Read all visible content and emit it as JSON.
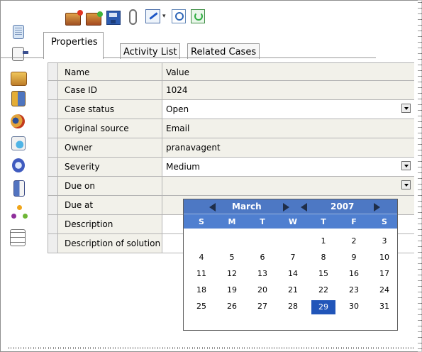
{
  "toolbar": {
    "buttons": [
      "new-case-icon",
      "open-case-icon",
      "save-icon",
      "attachment-icon",
      "edit-icon",
      "find-icon",
      "refresh-icon"
    ]
  },
  "sidebar": {
    "items": [
      "notes-icon",
      "form-icon",
      "case-icon",
      "people-icon",
      "contact-icon",
      "report-icon",
      "book-icon",
      "document-icon",
      "network-icon",
      "workflow-icon"
    ]
  },
  "tabs": [
    {
      "label": "Properties",
      "active": true
    },
    {
      "label": "Activity List",
      "active": false
    },
    {
      "label": "Related Cases",
      "active": false
    }
  ],
  "grid": {
    "header": {
      "name": "Name",
      "value": "Value"
    },
    "rows": [
      {
        "name": "Case ID",
        "value": "1024"
      },
      {
        "name": "Case status",
        "value": "Open"
      },
      {
        "name": "Original source",
        "value": "Email"
      },
      {
        "name": "Owner",
        "value": "pranavagent"
      },
      {
        "name": "Severity",
        "value": "Medium"
      },
      {
        "name": "Due on",
        "value": ""
      },
      {
        "name": "Due at",
        "value": ""
      },
      {
        "name": "Description",
        "value": ""
      },
      {
        "name": "Description of solution",
        "value": ""
      }
    ]
  },
  "calendar": {
    "month": "March",
    "year": "2007",
    "weekdays": [
      "S",
      "M",
      "T",
      "W",
      "T",
      "F",
      "S"
    ],
    "weeks": [
      [
        "",
        "",
        "",
        "",
        "1",
        "2",
        "3"
      ],
      [
        "4",
        "5",
        "6",
        "7",
        "8",
        "9",
        "10"
      ],
      [
        "11",
        "12",
        "13",
        "14",
        "15",
        "16",
        "17"
      ],
      [
        "18",
        "19",
        "20",
        "21",
        "22",
        "23",
        "24"
      ],
      [
        "25",
        "26",
        "27",
        "28",
        "29",
        "30",
        "31"
      ]
    ],
    "selected_day": "29",
    "colors": {
      "header": "#4d78c4",
      "selected": "#2155b9"
    }
  }
}
